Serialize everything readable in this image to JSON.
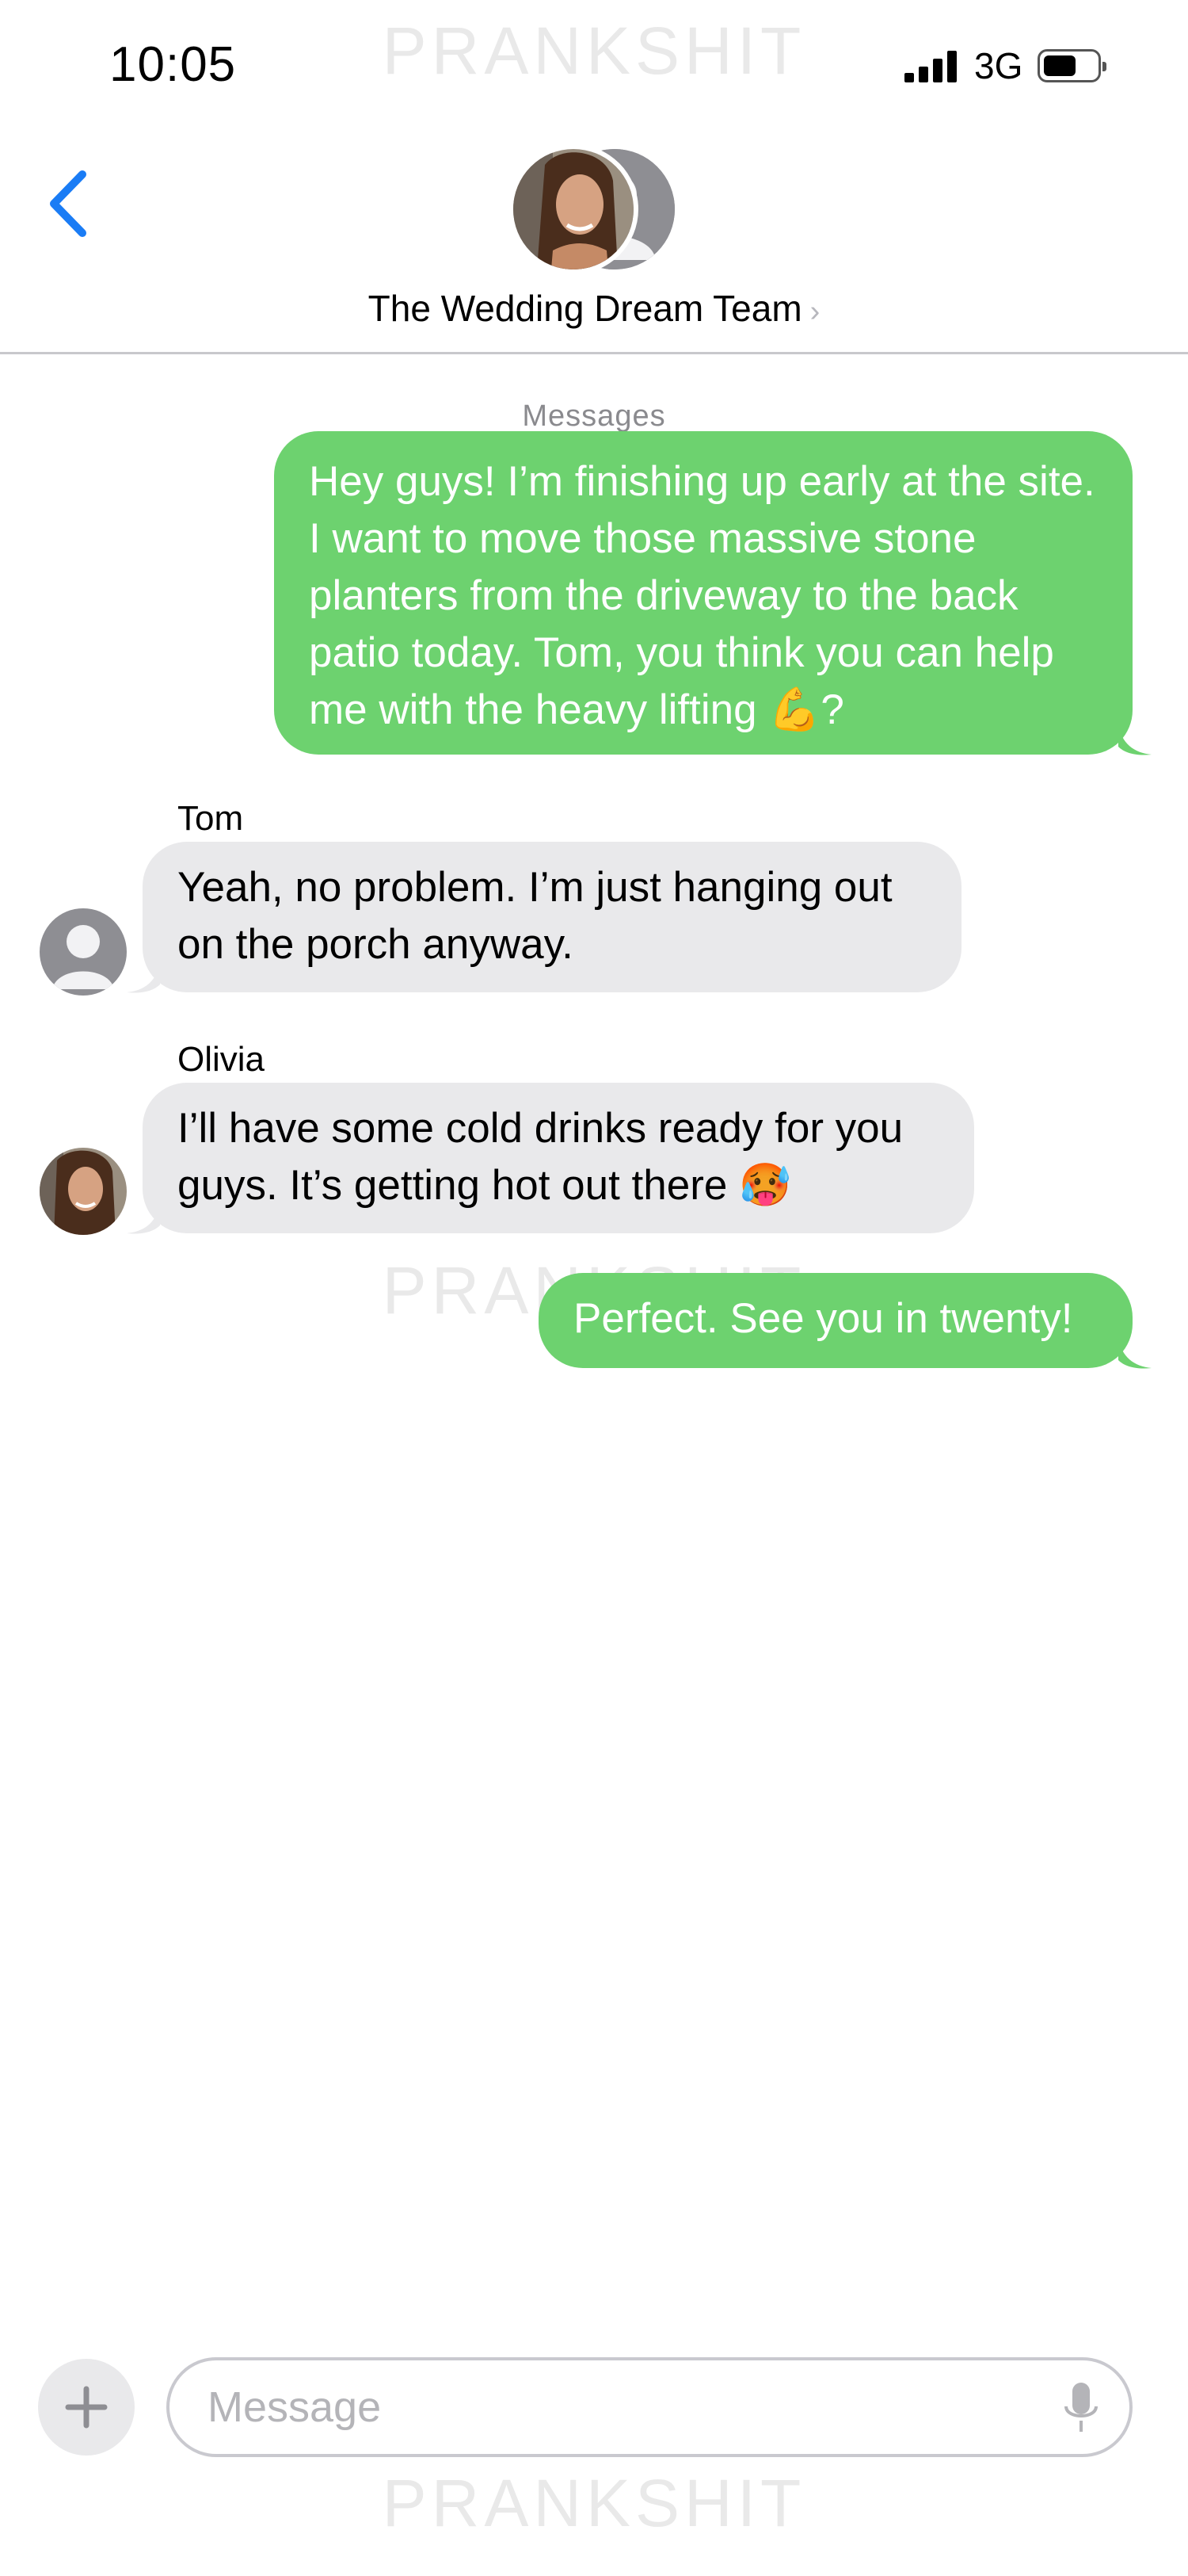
{
  "watermark": "PRANKSHIT",
  "status_bar": {
    "time": "10:05",
    "network": "3G"
  },
  "header": {
    "group_name": "The Wedding Dream Team",
    "chevron": "›"
  },
  "service_label": "Messages",
  "messages": [
    {
      "direction": "outgoing",
      "text": "Hey guys! I’m finishing up early at the site. I want to move those massive stone planters from the driveway to the back patio today. Tom, you think you can help me with the heavy lifting 💪?"
    },
    {
      "direction": "incoming",
      "sender": "Tom",
      "text": "Yeah, no problem. I’m just hanging out on the porch anyway."
    },
    {
      "direction": "incoming",
      "sender": "Olivia",
      "text": "I’ll have some cold drinks ready for you guys. It’s getting hot out there 🥵"
    },
    {
      "direction": "outgoing",
      "text": "Perfect. See you in twenty!"
    }
  ],
  "compose": {
    "placeholder": "Message"
  },
  "icons": {
    "back": "chevron-left-icon",
    "add": "plus-icon",
    "mic": "microphone-icon",
    "signal": "signal-bars-icon",
    "battery": "battery-icon"
  },
  "colors": {
    "outgoing_bubble": "#6dd26f",
    "incoming_bubble": "#e9e9eb",
    "accent": "#1a7cf5"
  }
}
